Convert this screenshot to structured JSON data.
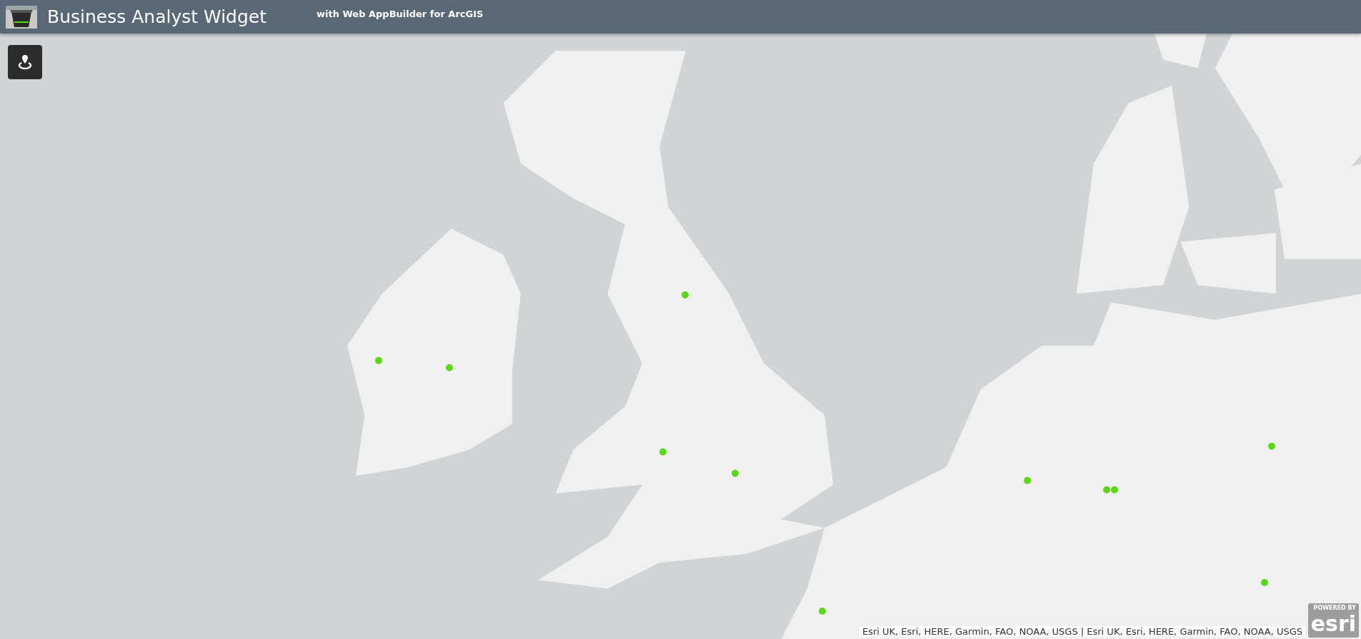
{
  "header": {
    "title": "Business Analyst Widget",
    "subtitle": "with Web AppBuilder for ArcGIS"
  },
  "attribution": "Esri UK, Esri, HERE, Garmin, FAO, NOAA, USGS | Esri UK, Esri, HERE, Garmin, FAO, NOAA, USGS",
  "logo": {
    "caption": "POWERED BY",
    "wordmark": "esri"
  }
}
